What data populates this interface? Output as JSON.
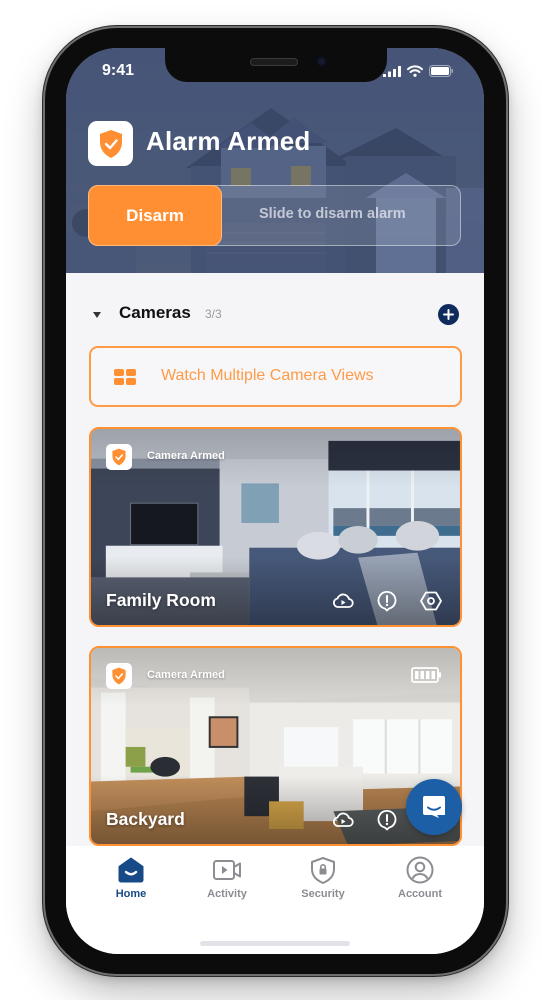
{
  "status_bar": {
    "time": "9:41"
  },
  "header": {
    "title": "Alarm Armed",
    "disarm_label": "Disarm",
    "slider_hint": "Slide to disarm alarm"
  },
  "cameras": {
    "title": "Cameras",
    "count": "3/3",
    "watch_multiple_label": "Watch Multiple Camera Views",
    "items": [
      {
        "name": "Family Room",
        "status": "Camera Armed",
        "actions": [
          "cloud-play",
          "alert",
          "settings"
        ],
        "battery": null
      },
      {
        "name": "Backyard",
        "status": "Camera Armed",
        "actions": [
          "cloud-play",
          "alert"
        ],
        "battery": "full"
      }
    ]
  },
  "tabbar": {
    "items": [
      {
        "label": "Home",
        "icon": "home-icon",
        "active": true
      },
      {
        "label": "Activity",
        "icon": "video-icon",
        "active": false
      },
      {
        "label": "Security",
        "icon": "shield-lock-icon",
        "active": false
      },
      {
        "label": "Account",
        "icon": "user-circle-icon",
        "active": false
      }
    ]
  },
  "colors": {
    "accent": "#ff8f32",
    "brand_navy": "#0f2b5c",
    "tab_active": "#174a86",
    "chat_fab": "#1d5fa6"
  }
}
